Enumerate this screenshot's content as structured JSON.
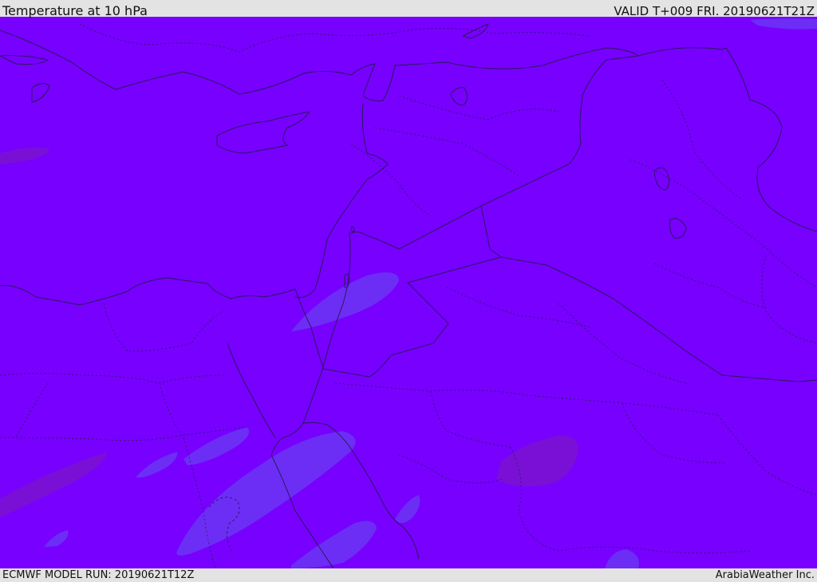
{
  "header": {
    "title": "Temperature at 10 hPa",
    "valid": "VALID T+009 FRI. 20190621T21Z"
  },
  "footer": {
    "model_run": "ECMWF MODEL RUN: 20190621T12Z",
    "credit": "ArabiaWeather Inc."
  },
  "colors": {
    "base_field": "#7700fe",
    "cooler_patch": "#6c2ef5",
    "warmer_patch": "#7a10d6",
    "coastline": "#2a1a5a",
    "border": "#2a1a5a",
    "background": "#e3e3e3"
  }
}
